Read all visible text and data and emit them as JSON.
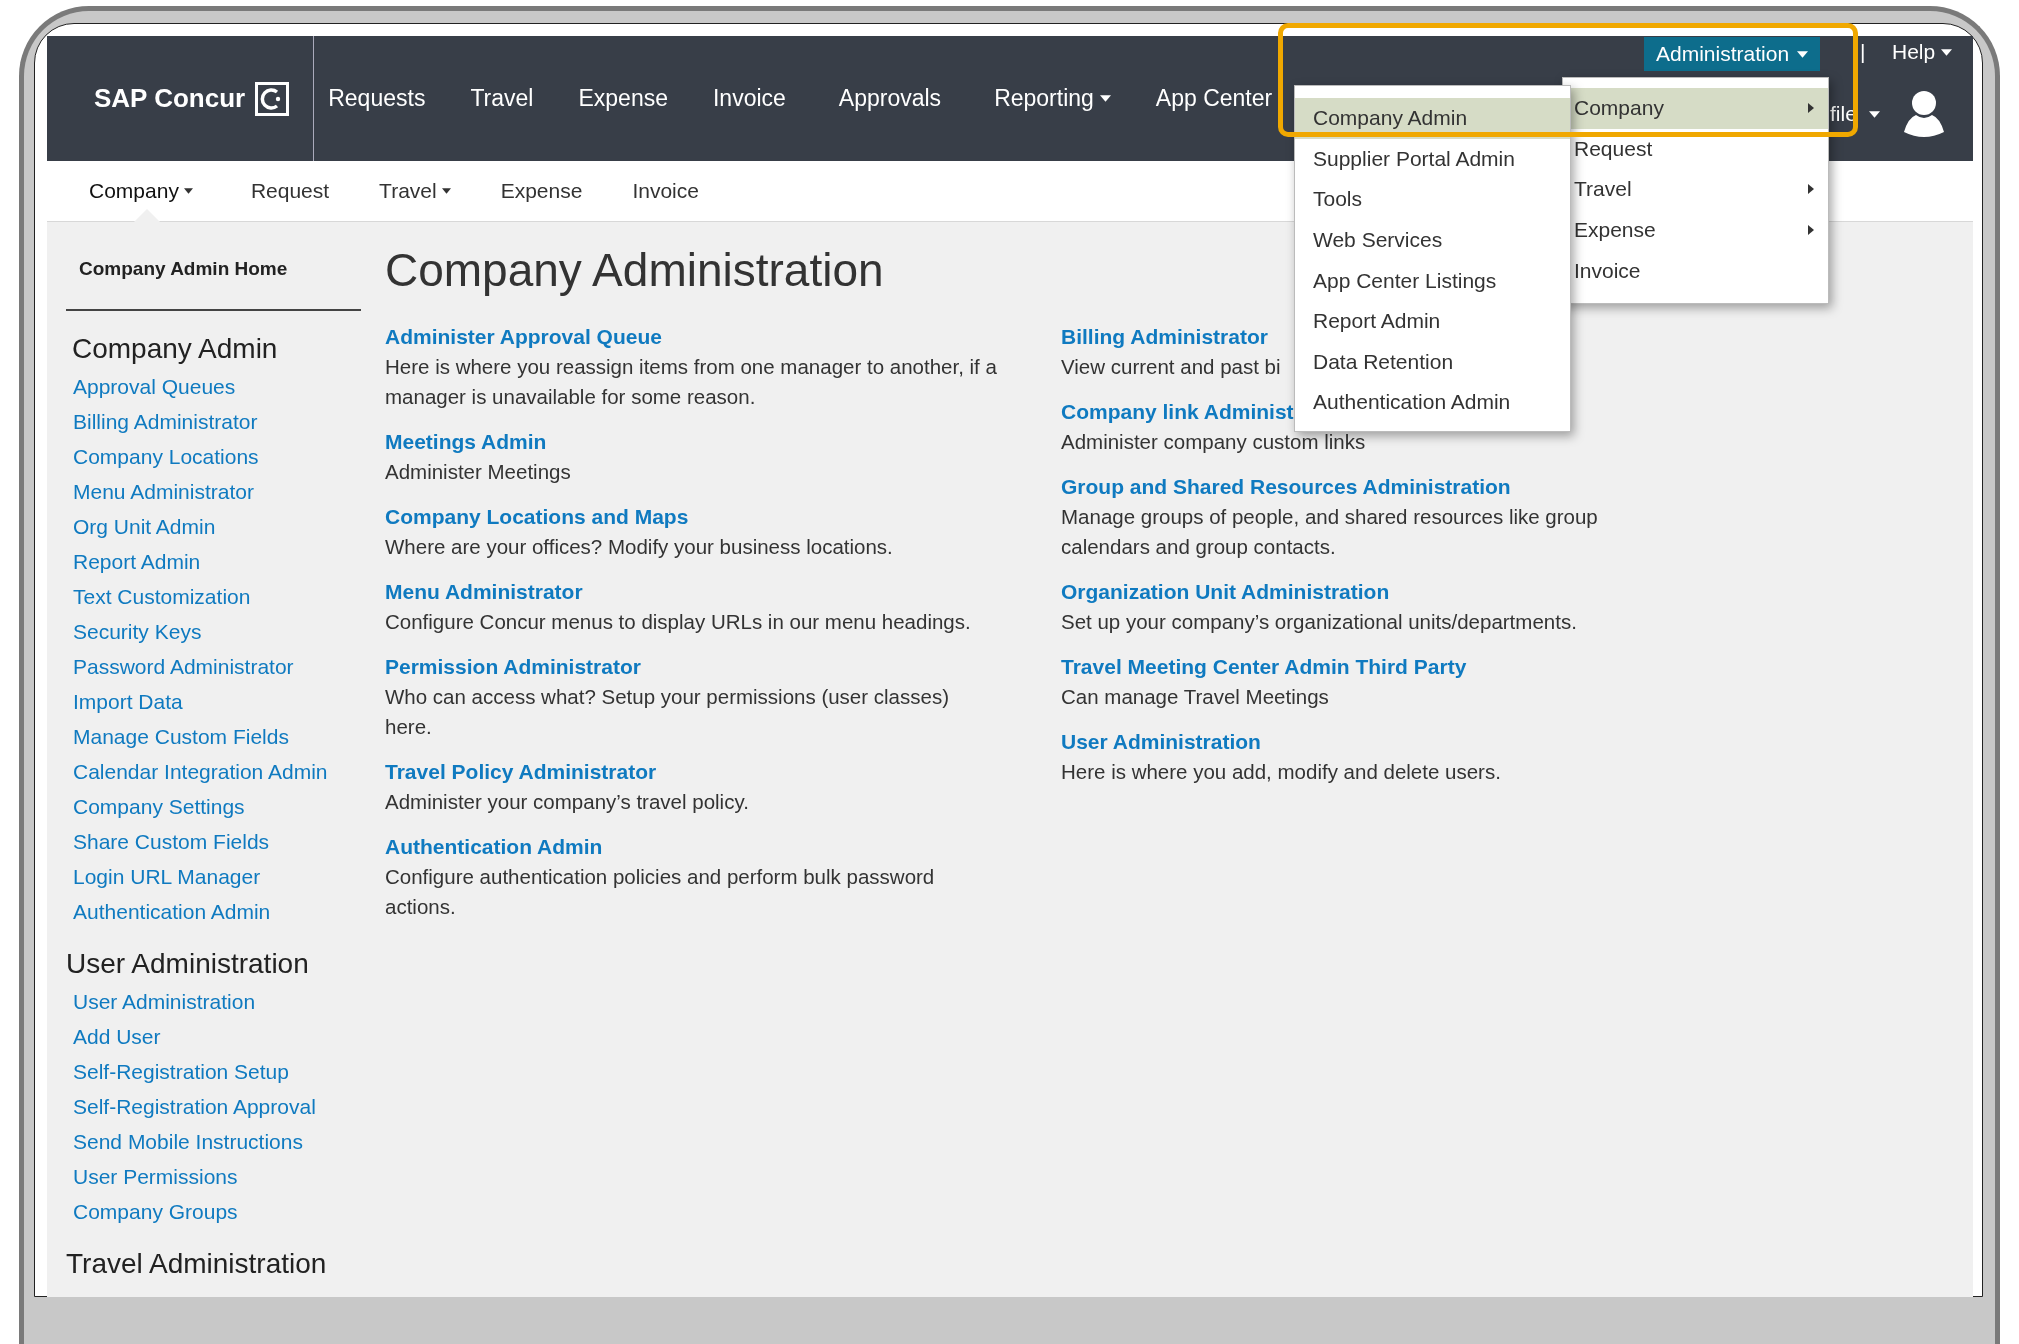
{
  "top_nav": {
    "logo": "SAP Concur",
    "items": [
      {
        "label": "Requests",
        "has_caret": false
      },
      {
        "label": "Travel",
        "has_caret": false
      },
      {
        "label": "Expense",
        "has_caret": false
      },
      {
        "label": "Invoice",
        "has_caret": false
      },
      {
        "label": "Approvals",
        "has_caret": false
      },
      {
        "label": "Reporting",
        "has_caret": true
      },
      {
        "label": "App Center",
        "has_caret": false
      }
    ],
    "administration": {
      "label": "Administration",
      "selected": true
    },
    "separator": "|",
    "help": {
      "label": "Help"
    },
    "profile": {
      "label": "file"
    }
  },
  "sub_nav": [
    {
      "label": "Company",
      "has_caret": true,
      "selected": true
    },
    {
      "label": "Request",
      "has_caret": false,
      "selected": false
    },
    {
      "label": "Travel",
      "has_caret": true,
      "selected": false
    },
    {
      "label": "Expense",
      "has_caret": false,
      "selected": false
    },
    {
      "label": "Invoice",
      "has_caret": false,
      "selected": false
    }
  ],
  "sidebar": {
    "home": "Company Admin Home",
    "sections": [
      {
        "title": "Company Admin",
        "links": [
          "Approval Queues",
          "Billing Administrator",
          "Company Locations",
          "Menu Administrator",
          "Org Unit Admin",
          "Report Admin",
          "Text Customization",
          "Security Keys",
          "Password Administrator",
          "Import Data",
          "Manage Custom Fields",
          "Calendar Integration Admin",
          "Company Settings",
          "Share Custom Fields",
          "Login URL Manager",
          "Authentication Admin"
        ]
      },
      {
        "title": "User Administration",
        "links": [
          "User Administration",
          "Add User",
          "Self-Registration Setup",
          "Self-Registration Approval",
          "Send Mobile Instructions",
          "User Permissions",
          "Company Groups"
        ]
      },
      {
        "title": "Travel Administration"
      }
    ]
  },
  "main": {
    "title": "Company Administration",
    "columns": [
      [
        {
          "title": "Administer Approval Queue",
          "description": "Here is where you reassign items from one manager to another, if a manager is unavailable for some reason."
        },
        {
          "title": "Meetings Admin",
          "description": "Administer Meetings"
        },
        {
          "title": "Company Locations and Maps",
          "description": "Where are your offices? Modify your business locations."
        },
        {
          "title": "Menu Administrator",
          "description": "Configure Concur menus to display URLs in our menu headings."
        },
        {
          "title": "Permission Administrator",
          "description": "Who can access what? Setup your permissions (user classes) here."
        },
        {
          "title": "Travel Policy Administrator",
          "description": "Administer your company’s travel policy."
        },
        {
          "title": "Authentication Admin",
          "description": "Configure authentication policies and perform bulk password actions."
        }
      ],
      [
        {
          "title": "Billing Administrator",
          "description": "View current and past bi"
        },
        {
          "title": "Company link Administ",
          "description": "Administer company custom links"
        },
        {
          "title": "Group and Shared Resources Administration",
          "description": "Manage groups of people, and shared resources like group calendars and group contacts."
        },
        {
          "title": "Organization Unit Administration",
          "description": "Set up your company’s organizational units/departments."
        },
        {
          "title": "Travel Meeting Center Admin Third Party",
          "description": "Can manage Travel Meetings"
        },
        {
          "title": "User Administration",
          "description": "Here is where you add, modify and delete users."
        }
      ]
    ]
  },
  "administration_menu": [
    {
      "label": "Company Admin",
      "selected": true
    },
    {
      "label": "Supplier Portal Admin",
      "selected": false
    },
    {
      "label": "Tools",
      "selected": false
    },
    {
      "label": "Web Services",
      "selected": false
    },
    {
      "label": "App Center Listings",
      "selected": false
    },
    {
      "label": "Report Admin",
      "selected": false
    },
    {
      "label": "Data Retention",
      "selected": false
    },
    {
      "label": "Authentication Admin",
      "selected": false
    }
  ],
  "category_menu": [
    {
      "label": "Company",
      "selected": true,
      "has_submenu": true
    },
    {
      "label": "Request",
      "selected": false,
      "has_submenu": false
    },
    {
      "label": "Travel",
      "selected": false,
      "has_submenu": true
    },
    {
      "label": "Expense",
      "selected": false,
      "has_submenu": true
    },
    {
      "label": "Invoice",
      "selected": false,
      "has_submenu": false
    }
  ]
}
